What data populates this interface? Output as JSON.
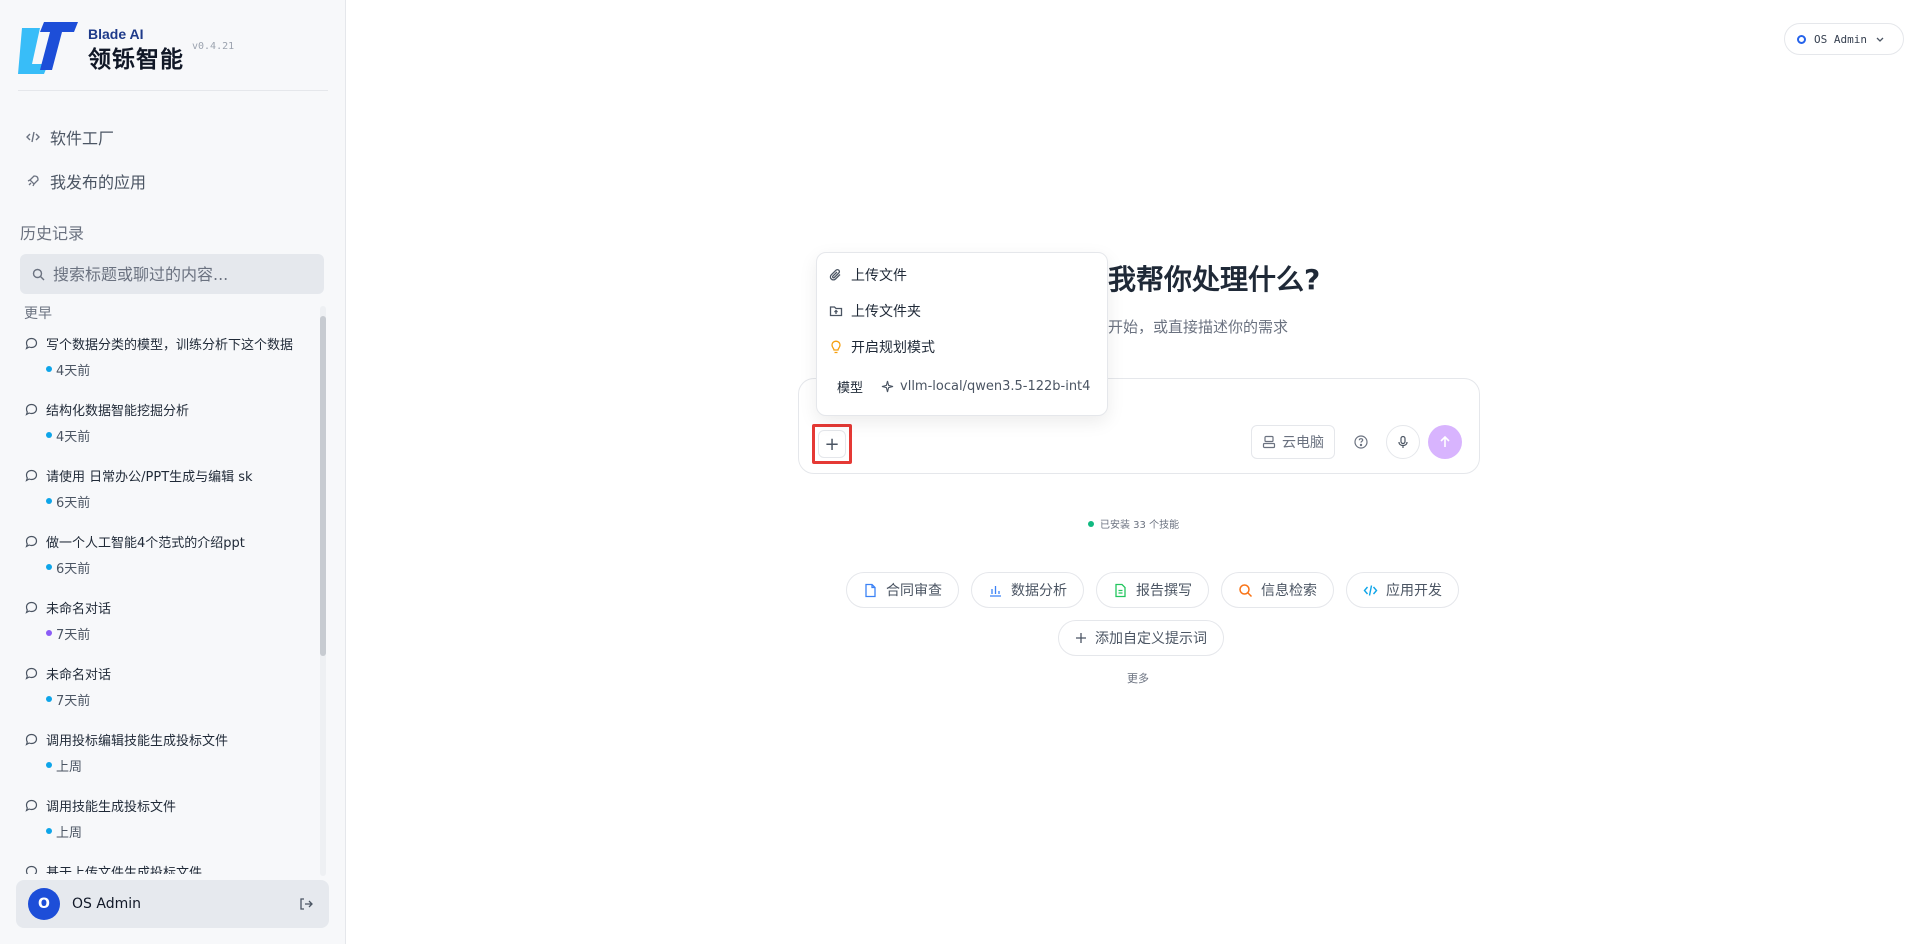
{
  "brand": {
    "name_en": "Blade AI",
    "name_cn": "领铄智能",
    "version": "v0.4.21"
  },
  "nav": [
    {
      "label": "软件工厂",
      "icon": "code-icon"
    },
    {
      "label": "我发布的应用",
      "icon": "rocket-icon"
    }
  ],
  "history": {
    "title": "历史记录",
    "search_placeholder": "搜索标题或聊过的内容...",
    "group": "更早",
    "items": [
      {
        "title": "写个数据分类的模型，训练分析下这个数据",
        "time": "4天前",
        "dot": "#0ea5e9"
      },
      {
        "title": "结构化数据智能挖掘分析",
        "time": "4天前",
        "dot": "#0ea5e9"
      },
      {
        "title": "请使用 日常办公/PPT生成与编辑 sk",
        "time": "6天前",
        "dot": "#0ea5e9"
      },
      {
        "title": "做一个人工智能4个范式的介绍ppt",
        "time": "6天前",
        "dot": "#0ea5e9"
      },
      {
        "title": "未命名对话",
        "time": "7天前",
        "dot": "#8b5cf6"
      },
      {
        "title": "未命名对话",
        "time": "7天前",
        "dot": "#0ea5e9"
      },
      {
        "title": "调用投标编辑技能生成投标文件",
        "time": "上周",
        "dot": "#0ea5e9"
      },
      {
        "title": "调用技能生成投标文件",
        "time": "上周",
        "dot": "#0ea5e9"
      },
      {
        "title": "基于上传文件生成投标文件",
        "time": "",
        "dot": "#0ea5e9"
      }
    ]
  },
  "user": {
    "initial": "O",
    "name": "OS Admin"
  },
  "header": {
    "account_label": "OS Admin"
  },
  "main": {
    "headline": "我帮你处理什么?",
    "subline": "开始，或直接描述你的需求",
    "cloud_label": "云电脑",
    "skills_text": "已安装  33  个技能",
    "chips": [
      {
        "label": "合同审查",
        "icon": "contract-icon",
        "color": "#3b82f6"
      },
      {
        "label": "数据分析",
        "icon": "bar-chart-icon",
        "color": "#3b82f6"
      },
      {
        "label": "报告撰写",
        "icon": "document-icon",
        "color": "#22c55e"
      },
      {
        "label": "信息检索",
        "icon": "search-icon",
        "color": "#f97316"
      },
      {
        "label": "应用开发",
        "icon": "code-icon",
        "color": "#0ea5e9"
      }
    ],
    "add_prompt": "添加自定义提示词",
    "more": "更多"
  },
  "dropdown": {
    "items": [
      {
        "label": "上传文件",
        "icon": "paperclip-icon"
      },
      {
        "label": "上传文件夹",
        "icon": "folder-upload-icon"
      },
      {
        "label": "开启规划模式",
        "icon": "lightbulb-icon"
      }
    ],
    "model_label": "模型",
    "model_value": "vllm-local/qwen3.5-122b-int4"
  },
  "colors": {
    "accent": "#2563eb",
    "send": "#d8b4fe",
    "highlight": "#e53935"
  }
}
